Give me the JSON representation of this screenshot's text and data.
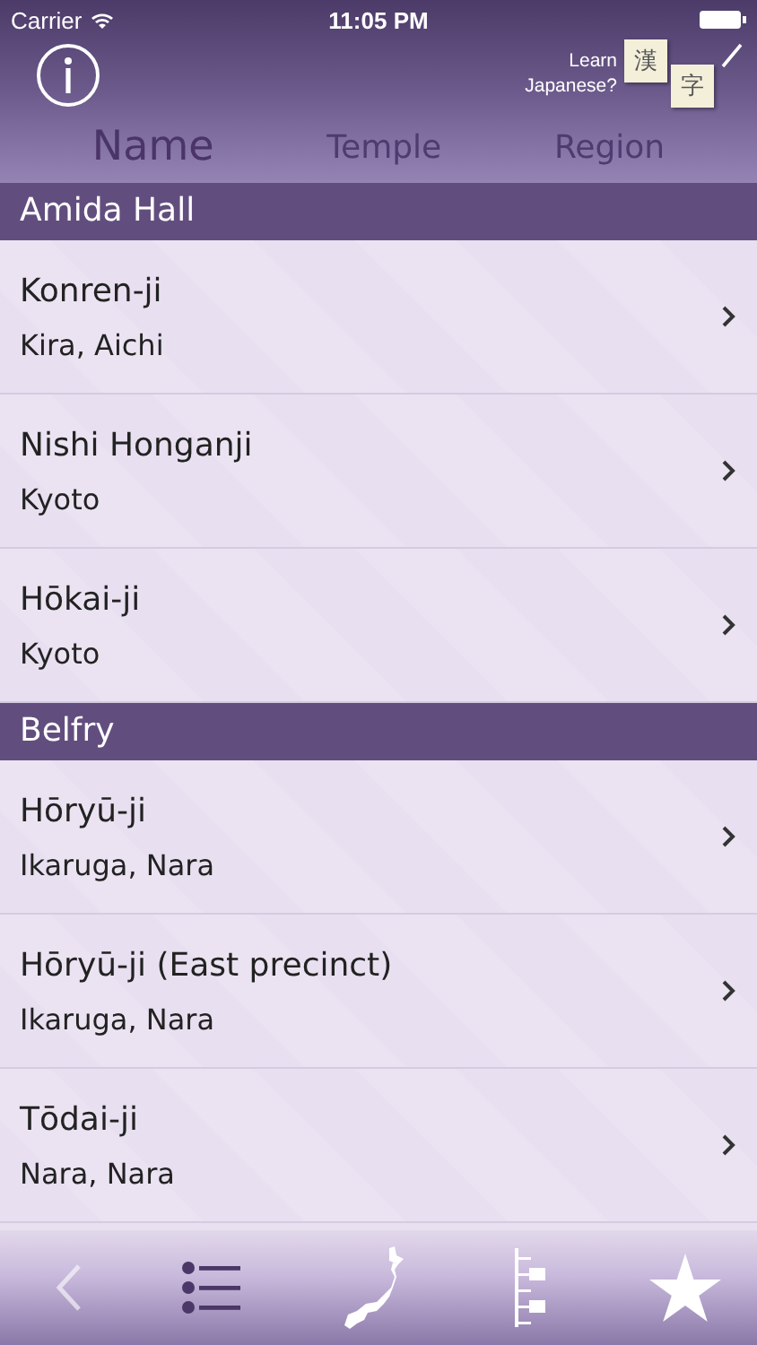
{
  "status_bar": {
    "carrier": "Carrier",
    "time": "11:05 PM"
  },
  "header": {
    "learn_prompt": "Learn Japanese?",
    "kanji_cards": [
      "漢",
      "字"
    ]
  },
  "sort_tabs": [
    {
      "label": "Name",
      "selected": true
    },
    {
      "label": "Temple",
      "selected": false
    },
    {
      "label": "Region",
      "selected": false
    }
  ],
  "sections": [
    {
      "title": "Amida Hall",
      "rows": [
        {
          "name": "Konren-ji",
          "place": "Kira, Aichi"
        },
        {
          "name": "Nishi Honganji",
          "place": "Kyoto"
        },
        {
          "name": "Hōkai-ji",
          "place": "Kyoto"
        }
      ]
    },
    {
      "title": "Belfry",
      "rows": [
        {
          "name": "Hōryū-ji",
          "place": "Ikaruga, Nara"
        },
        {
          "name": "Hōryū-ji (East precinct)",
          "place": "Ikaruga, Nara"
        },
        {
          "name": "Tōdai-ji",
          "place": "Nara, Nara"
        }
      ]
    }
  ],
  "tab_bar": [
    {
      "kind": "list",
      "selected": true
    },
    {
      "kind": "map",
      "selected": false
    },
    {
      "kind": "tree",
      "selected": false
    },
    {
      "kind": "star",
      "selected": false
    }
  ]
}
